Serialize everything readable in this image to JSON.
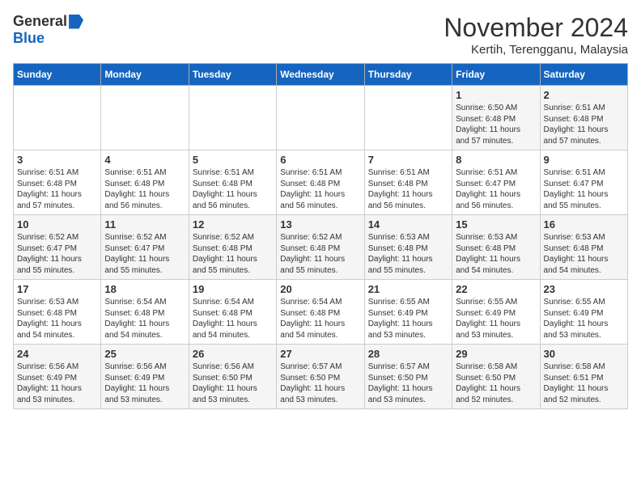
{
  "header": {
    "logo_general": "General",
    "logo_blue": "Blue",
    "month_title": "November 2024",
    "location": "Kertih, Terengganu, Malaysia"
  },
  "days_of_week": [
    "Sunday",
    "Monday",
    "Tuesday",
    "Wednesday",
    "Thursday",
    "Friday",
    "Saturday"
  ],
  "weeks": [
    [
      {
        "day": "",
        "info": ""
      },
      {
        "day": "",
        "info": ""
      },
      {
        "day": "",
        "info": ""
      },
      {
        "day": "",
        "info": ""
      },
      {
        "day": "",
        "info": ""
      },
      {
        "day": "1",
        "info": "Sunrise: 6:50 AM\nSunset: 6:48 PM\nDaylight: 11 hours\nand 57 minutes."
      },
      {
        "day": "2",
        "info": "Sunrise: 6:51 AM\nSunset: 6:48 PM\nDaylight: 11 hours\nand 57 minutes."
      }
    ],
    [
      {
        "day": "3",
        "info": "Sunrise: 6:51 AM\nSunset: 6:48 PM\nDaylight: 11 hours\nand 57 minutes."
      },
      {
        "day": "4",
        "info": "Sunrise: 6:51 AM\nSunset: 6:48 PM\nDaylight: 11 hours\nand 56 minutes."
      },
      {
        "day": "5",
        "info": "Sunrise: 6:51 AM\nSunset: 6:48 PM\nDaylight: 11 hours\nand 56 minutes."
      },
      {
        "day": "6",
        "info": "Sunrise: 6:51 AM\nSunset: 6:48 PM\nDaylight: 11 hours\nand 56 minutes."
      },
      {
        "day": "7",
        "info": "Sunrise: 6:51 AM\nSunset: 6:48 PM\nDaylight: 11 hours\nand 56 minutes."
      },
      {
        "day": "8",
        "info": "Sunrise: 6:51 AM\nSunset: 6:47 PM\nDaylight: 11 hours\nand 56 minutes."
      },
      {
        "day": "9",
        "info": "Sunrise: 6:51 AM\nSunset: 6:47 PM\nDaylight: 11 hours\nand 55 minutes."
      }
    ],
    [
      {
        "day": "10",
        "info": "Sunrise: 6:52 AM\nSunset: 6:47 PM\nDaylight: 11 hours\nand 55 minutes."
      },
      {
        "day": "11",
        "info": "Sunrise: 6:52 AM\nSunset: 6:47 PM\nDaylight: 11 hours\nand 55 minutes."
      },
      {
        "day": "12",
        "info": "Sunrise: 6:52 AM\nSunset: 6:48 PM\nDaylight: 11 hours\nand 55 minutes."
      },
      {
        "day": "13",
        "info": "Sunrise: 6:52 AM\nSunset: 6:48 PM\nDaylight: 11 hours\nand 55 minutes."
      },
      {
        "day": "14",
        "info": "Sunrise: 6:53 AM\nSunset: 6:48 PM\nDaylight: 11 hours\nand 55 minutes."
      },
      {
        "day": "15",
        "info": "Sunrise: 6:53 AM\nSunset: 6:48 PM\nDaylight: 11 hours\nand 54 minutes."
      },
      {
        "day": "16",
        "info": "Sunrise: 6:53 AM\nSunset: 6:48 PM\nDaylight: 11 hours\nand 54 minutes."
      }
    ],
    [
      {
        "day": "17",
        "info": "Sunrise: 6:53 AM\nSunset: 6:48 PM\nDaylight: 11 hours\nand 54 minutes."
      },
      {
        "day": "18",
        "info": "Sunrise: 6:54 AM\nSunset: 6:48 PM\nDaylight: 11 hours\nand 54 minutes."
      },
      {
        "day": "19",
        "info": "Sunrise: 6:54 AM\nSunset: 6:48 PM\nDaylight: 11 hours\nand 54 minutes."
      },
      {
        "day": "20",
        "info": "Sunrise: 6:54 AM\nSunset: 6:48 PM\nDaylight: 11 hours\nand 54 minutes."
      },
      {
        "day": "21",
        "info": "Sunrise: 6:55 AM\nSunset: 6:49 PM\nDaylight: 11 hours\nand 53 minutes."
      },
      {
        "day": "22",
        "info": "Sunrise: 6:55 AM\nSunset: 6:49 PM\nDaylight: 11 hours\nand 53 minutes."
      },
      {
        "day": "23",
        "info": "Sunrise: 6:55 AM\nSunset: 6:49 PM\nDaylight: 11 hours\nand 53 minutes."
      }
    ],
    [
      {
        "day": "24",
        "info": "Sunrise: 6:56 AM\nSunset: 6:49 PM\nDaylight: 11 hours\nand 53 minutes."
      },
      {
        "day": "25",
        "info": "Sunrise: 6:56 AM\nSunset: 6:49 PM\nDaylight: 11 hours\nand 53 minutes."
      },
      {
        "day": "26",
        "info": "Sunrise: 6:56 AM\nSunset: 6:50 PM\nDaylight: 11 hours\nand 53 minutes."
      },
      {
        "day": "27",
        "info": "Sunrise: 6:57 AM\nSunset: 6:50 PM\nDaylight: 11 hours\nand 53 minutes."
      },
      {
        "day": "28",
        "info": "Sunrise: 6:57 AM\nSunset: 6:50 PM\nDaylight: 11 hours\nand 53 minutes."
      },
      {
        "day": "29",
        "info": "Sunrise: 6:58 AM\nSunset: 6:50 PM\nDaylight: 11 hours\nand 52 minutes."
      },
      {
        "day": "30",
        "info": "Sunrise: 6:58 AM\nSunset: 6:51 PM\nDaylight: 11 hours\nand 52 minutes."
      }
    ]
  ]
}
